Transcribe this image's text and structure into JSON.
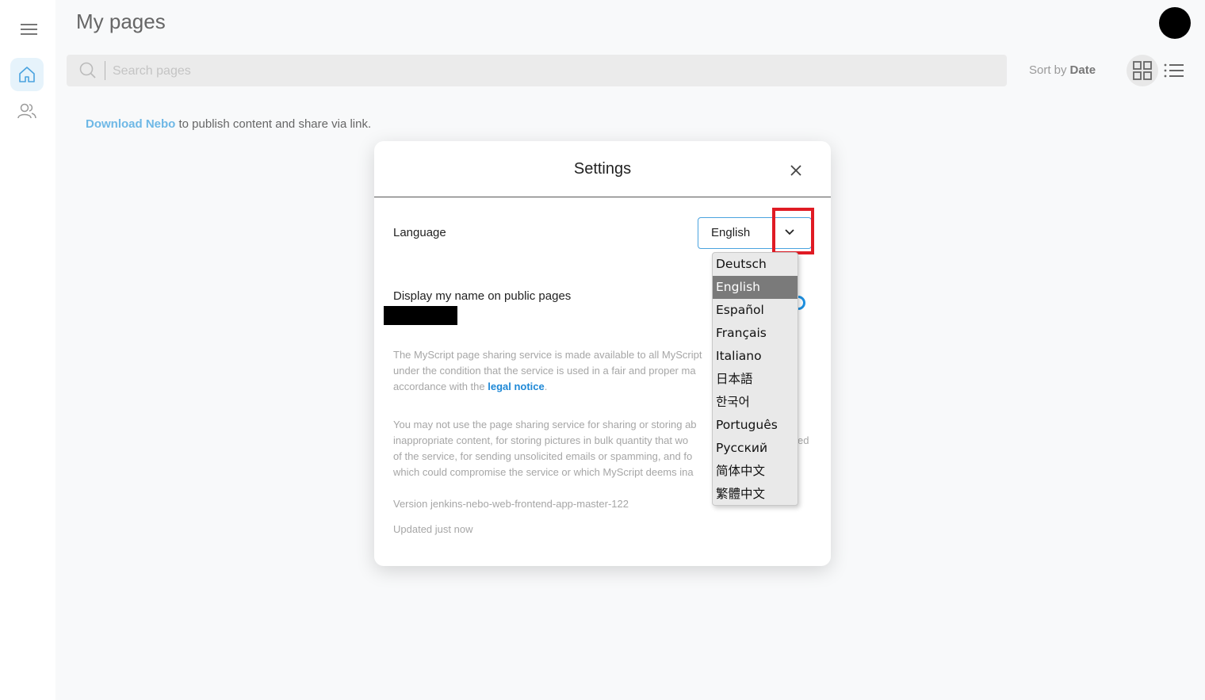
{
  "header": {
    "title": "My pages"
  },
  "sidebar": {
    "items": [
      {
        "icon": "menu-icon"
      },
      {
        "icon": "home-icon",
        "active": true
      },
      {
        "icon": "users-icon"
      }
    ]
  },
  "search": {
    "placeholder": "Search pages",
    "value": ""
  },
  "sort": {
    "label": "Sort by",
    "value": "Date"
  },
  "notice": {
    "link_text": "Download Nebo",
    "rest_text": " to publish content and share via link."
  },
  "settings": {
    "title": "Settings",
    "language_label": "Language",
    "language_value": "English",
    "display_name_label": "Display my name on public pages",
    "para1_text": "The MyScript page sharing service is made available to all MyScript",
    "para1_line2": "under the condition that the service is used in a fair and proper ma",
    "para1_line3_pre": "accordance with the ",
    "para1_link": "legal notice",
    "para1_line3_post": ".",
    "para2_line1": "You may not use the page sharing service for sharing or storing ab",
    "para2_line2": "inappropriate content, for storing pictures in bulk quantity that wo",
    "para2_line2_tail": "ed",
    "para2_line3": "of the service, for sending unsolicited emails or spamming, and fo",
    "para2_line4": "which could compromise the service or which MyScript deems ina",
    "version": "Version jenkins-nebo-web-frontend-app-master-122",
    "updated": "Updated just now"
  },
  "language_options": [
    "Deutsch",
    "English",
    "Español",
    "Français",
    "Italiano",
    "日本語",
    "한국어",
    "Português",
    "Русский",
    "简体中文",
    "繁體中文"
  ],
  "selected_language": "English",
  "colors": {
    "accent": "#4aa3df",
    "link": "#6eb8e6",
    "highlight_box": "#e01b24",
    "selected_option": "#7a7a7a"
  }
}
